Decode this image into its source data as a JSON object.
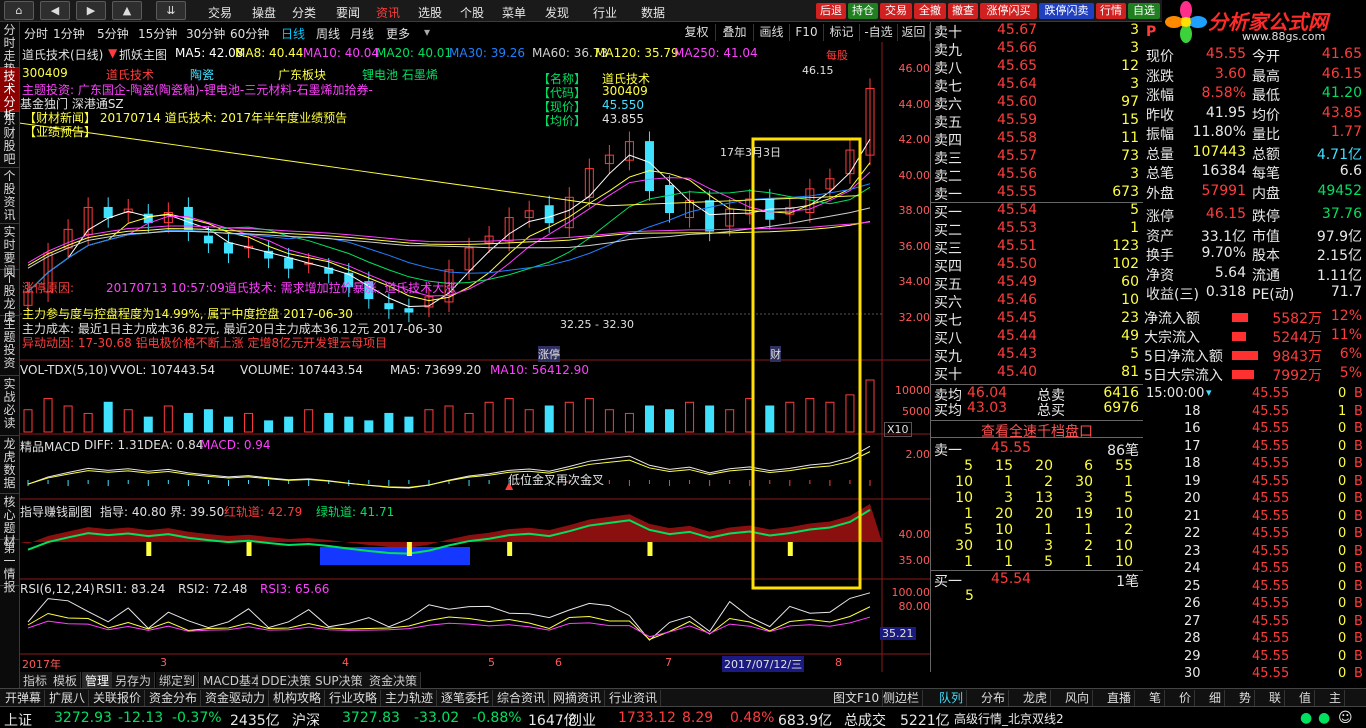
{
  "toolbar": {
    "nav_icons": [
      "home-icon",
      "back-icon",
      "forward-icon",
      "up-icon",
      "collapse-icon"
    ],
    "menus": [
      "交易",
      "操盘",
      "分类",
      "要闻",
      "资讯",
      "选股",
      "个股",
      "菜单",
      "发现",
      "行业",
      "数据"
    ],
    "active_menu": "资讯",
    "right_buttons": [
      "后退",
      "持仓",
      "交易",
      "全撤",
      "撤查",
      "涨停闪买",
      "跌停闪卖",
      "行情",
      "自选"
    ],
    "logo_text": "分析家公式网",
    "logo_url": "www.88gs.com"
  },
  "left_tabs": [
    "分时走势",
    "技术分析",
    "东财股吧",
    "个股资讯",
    "实时要闻",
    "个股龙虎",
    "主题投资",
    "实战必读",
    "龙虎数据",
    "核心题材",
    "第一情报"
  ],
  "period": {
    "items": [
      "分时",
      "1分钟",
      "5分钟",
      "15分钟",
      "30分钟",
      "60分钟",
      "日线",
      "周线",
      "月线",
      "更多"
    ],
    "active": "日线"
  },
  "chart_controls": [
    "复权",
    "叠加",
    "画线",
    "F10",
    "标记",
    "-自选",
    "返回"
  ],
  "main_chart": {
    "title_line": "道氏技术(日线)",
    "pick_label": "抓妖主图",
    "ma": [
      {
        "label": "MA5: 42.08",
        "color": "#ffffff"
      },
      {
        "label": "MA8: 40.44",
        "color": "#ffff40"
      },
      {
        "label": "MA10: 40.04",
        "color": "#ff40ff"
      },
      {
        "label": "MA20: 40.01",
        "color": "#00e060"
      },
      {
        "label": "MA30: 39.26",
        "color": "#2080ff"
      },
      {
        "label": "MA60: 36.73",
        "color": "#d0d0d0"
      },
      {
        "label": "MA120: 35.79",
        "color": "#ffff40"
      },
      {
        "label": "MA250: 41.04",
        "color": "#ff40ff"
      }
    ],
    "code": "300409",
    "tags": [
      "道氏技术",
      "陶瓷",
      "广东板块",
      "锂电池 石墨烯"
    ],
    "concept_line": "主题投资: 广东国企-陶瓷(陶瓷釉)-锂电池-三元材料-石墨烯加拾券-",
    "market_line": "基金独门 深港通SZ",
    "news1": "【财材新闻】 20170714 道氏技术: 2017年半年度业绩预告",
    "news2": "【业绩预告】",
    "info_box": {
      "name_label": "【名称】",
      "name": "道氏技术",
      "code_label": "【代码】",
      "code": "300409",
      "price_label": "【现价】",
      "price": "45.550",
      "avg_label": "【均价】",
      "avg": "43.855"
    },
    "reason_label": "涨停原因:",
    "reason_text": "20170713 10:57:09道氏技术: 需求增加拉价暴涨, 道氏技术大涨",
    "fund_line": "主力参与度与控盘程度为14.99%, 属于中度控盘 2017-06-30",
    "cost_line": "主力成本: 最近1日主力成本36.82元, 最近20日主力成本36.12元 2017-06-30",
    "abnormal_line": "异动动因: 17-30.68 铝电极价格不断上涨 定增8亿元开发锂云母项目",
    "range_label": "32.25 - 32.30",
    "peak_label": "46.15",
    "date_marker": "17年3月3日",
    "stop_tag": "涨停",
    "cai_tag": "财",
    "meigu": "每股",
    "y_ticks": [
      "46.00",
      "44.00",
      "42.00",
      "40.00",
      "38.00",
      "36.00",
      "34.00",
      "32.00"
    ]
  },
  "chart_data": [
    {
      "type": "candlestick",
      "title": "道氏技术(日线)",
      "x": [
        "2017-03",
        "2017-04",
        "2017-05",
        "2017-06",
        "2017-07",
        "2017-08"
      ],
      "ylim": [
        31,
        47
      ],
      "series": [
        {
          "name": "MA5",
          "last": 42.08
        },
        {
          "name": "MA8",
          "last": 40.44
        },
        {
          "name": "MA10",
          "last": 40.04
        },
        {
          "name": "MA20",
          "last": 40.01
        },
        {
          "name": "MA30",
          "last": 39.26
        },
        {
          "name": "MA60",
          "last": 36.73
        },
        {
          "name": "MA120",
          "last": 35.79
        },
        {
          "name": "MA250",
          "last": 41.04
        }
      ],
      "close_path": [
        33.5,
        35.8,
        37.2,
        38.5,
        37.9,
        38.4,
        37.6,
        38.2,
        37.1,
        36.4,
        35.8,
        36.2,
        35.5,
        34.9,
        35.2,
        34.6,
        33.8,
        33.1,
        32.5,
        32.3,
        33.2,
        34.8,
        36.1,
        36.8,
        37.9,
        38.3,
        37.6,
        39.1,
        40.8,
        41.6,
        42.4,
        39.5,
        38.2,
        38.9,
        37.1,
        38.4,
        39.0,
        37.8,
        38.5,
        39.6,
        40.2,
        41.9,
        45.55
      ]
    },
    {
      "type": "bar",
      "title": "VOL-TDX(5,10)",
      "series": [
        {
          "name": "VOLUME",
          "last": 107443.54
        },
        {
          "name": "MA5",
          "last": 73699.2
        },
        {
          "name": "MA10",
          "last": 56412.9
        }
      ],
      "y_ticks": [
        "10000",
        "5000"
      ],
      "values": [
        6,
        9,
        7,
        5,
        8,
        6,
        4,
        7,
        5,
        6,
        4,
        5,
        3,
        4,
        6,
        5,
        4,
        3,
        5,
        4,
        6,
        7,
        5,
        8,
        9,
        6,
        7,
        8,
        9,
        6,
        5,
        7,
        6,
        8,
        7,
        6,
        9,
        7,
        8,
        9,
        8,
        10,
        14
      ]
    },
    {
      "type": "line",
      "title": "精品MACD",
      "series": [
        {
          "name": "DIFF",
          "last": 1.31
        },
        {
          "name": "DEA",
          "last": 0.84
        },
        {
          "name": "MACD",
          "last": 0.94
        }
      ],
      "y_ticks": [
        "2.00"
      ]
    },
    {
      "type": "area",
      "title": "指导赚钱副图",
      "series": [
        {
          "name": "指导",
          "last": 40.8
        },
        {
          "name": "界",
          "last": 39.5
        },
        {
          "name": "红轨道",
          "last": 42.79
        },
        {
          "name": "绿轨道",
          "last": 41.71
        }
      ],
      "y_ticks": [
        "40.00",
        "35.00"
      ]
    },
    {
      "type": "line",
      "title": "RSI(6,12,24)",
      "series": [
        {
          "name": "RSI1",
          "last": 83.24
        },
        {
          "name": "RSI2",
          "last": 72.48
        },
        {
          "name": "RSI3",
          "last": 65.66
        }
      ],
      "y_ticks": [
        "100.00",
        "80.00",
        "35.21"
      ]
    }
  ],
  "subcharts": {
    "vol_title": "VOL-TDX(5,10)",
    "vol_vals": "VVOL: 107443.54",
    "vol_volume": "VOLUME: 107443.54",
    "vol_ma5": "MA5: 73699.20",
    "vol_ma10": "MA10: 56412.90",
    "x10": "X10",
    "macd_title": "精品MACD",
    "macd_diff": "DIFF: 1.31",
    "macd_dea": "DEA: 0.84",
    "macd_macd": "MACD: 0.94",
    "macd_note": "低位金叉再次金叉",
    "guide_title": "指导赚钱副图",
    "guide_vals": "指导: 40.80 界: 39.50",
    "guide_red": "红轨道: 42.79",
    "guide_green": "绿轨道: 41.71",
    "rsi_title": "RSI(6,12,24)",
    "rsi1": "RSI1: 83.24",
    "rsi2": "RSI2: 72.48",
    "rsi3": "RSI3: 65.66"
  },
  "x_axis": {
    "labels": [
      "2017年",
      "3",
      "4",
      "5",
      "6",
      "7",
      "8"
    ],
    "cursor_date": "2017/07/12/三"
  },
  "chart_bottom_tabs": [
    "指标",
    "模板",
    "管理",
    "另存为",
    "绑定到",
    "MACD基本",
    "DDE决策",
    "SUP决策",
    "资金决策"
  ],
  "quote": {
    "sell": [
      {
        "label": "卖十",
        "price": "45.67",
        "vol": "3"
      },
      {
        "label": "卖九",
        "price": "45.66",
        "vol": "3"
      },
      {
        "label": "卖八",
        "price": "45.65",
        "vol": "12"
      },
      {
        "label": "卖七",
        "price": "45.64",
        "vol": "3"
      },
      {
        "label": "卖六",
        "price": "45.60",
        "vol": "97"
      },
      {
        "label": "卖五",
        "price": "45.59",
        "vol": "15"
      },
      {
        "label": "卖四",
        "price": "45.58",
        "vol": "11"
      },
      {
        "label": "卖三",
        "price": "45.57",
        "vol": "73"
      },
      {
        "label": "卖二",
        "price": "45.56",
        "vol": "3"
      },
      {
        "label": "卖一",
        "price": "45.55",
        "vol": "673"
      }
    ],
    "buy": [
      {
        "label": "买一",
        "price": "45.54",
        "vol": "5"
      },
      {
        "label": "买二",
        "price": "45.53",
        "vol": "1"
      },
      {
        "label": "买三",
        "price": "45.51",
        "vol": "123"
      },
      {
        "label": "买四",
        "price": "45.50",
        "vol": "102"
      },
      {
        "label": "买五",
        "price": "45.49",
        "vol": "60"
      },
      {
        "label": "买六",
        "price": "45.46",
        "vol": "10"
      },
      {
        "label": "买七",
        "price": "45.45",
        "vol": "23"
      },
      {
        "label": "买八",
        "price": "45.44",
        "vol": "49"
      },
      {
        "label": "买九",
        "price": "45.43",
        "vol": "5"
      },
      {
        "label": "买十",
        "price": "45.40",
        "vol": "81"
      }
    ],
    "avg_sell_label": "卖均",
    "avg_sell": "46.04",
    "total_sell_label": "总卖",
    "total_sell": "6416",
    "avg_buy_label": "买均",
    "avg_buy": "43.03",
    "total_buy_label": "总买",
    "total_buy": "6976",
    "depth_link": "查看全速千档盘口",
    "depth_sell1_label": "卖一",
    "depth_sell1_price": "45.55",
    "depth_sell1_count": "86笔",
    "depth_grid": [
      [
        "5",
        "15",
        "20",
        "6",
        "55"
      ],
      [
        "10",
        "1",
        "2",
        "30",
        "1"
      ],
      [
        "10",
        "3",
        "13",
        "3",
        "5"
      ],
      [
        "1",
        "20",
        "20",
        "19",
        "10"
      ],
      [
        "5",
        "10",
        "1",
        "1",
        "2"
      ],
      [
        "30",
        "10",
        "3",
        "2",
        "10"
      ],
      [
        "1",
        "1",
        "5",
        "1",
        "10"
      ]
    ],
    "depth_buy1_label": "买一",
    "depth_buy1_price": "45.54",
    "depth_buy1_count": "1笔",
    "depth_buy_first": "5"
  },
  "fund": {
    "title": "P",
    "rows": [
      {
        "l1": "现价",
        "v1": "45.55",
        "c1": "red",
        "l2": "今开",
        "v2": "41.65",
        "c2": "red"
      },
      {
        "l1": "涨跌",
        "v1": "3.60",
        "c1": "red",
        "l2": "最高",
        "v2": "46.15",
        "c2": "red"
      },
      {
        "l1": "涨幅",
        "v1": "8.58%",
        "c1": "red",
        "l2": "最低",
        "v2": "41.20",
        "c2": "grn"
      },
      {
        "l1": "昨收",
        "v1": "41.95",
        "c1": "wht",
        "l2": "均价",
        "v2": "43.85",
        "c2": "red"
      },
      {
        "l1": "振幅",
        "v1": "11.80%",
        "c1": "wht",
        "l2": "量比",
        "v2": "1.77",
        "c2": "red"
      },
      {
        "l1": "总量",
        "v1": "107443",
        "c1": "ylw",
        "l2": "总额",
        "v2": "4.71亿",
        "c2": "cyn"
      },
      {
        "l1": "总笔",
        "v1": "16384",
        "c1": "wht",
        "l2": "每笔",
        "v2": "6.6",
        "c2": "wht"
      },
      {
        "l1": "外盘",
        "v1": "57991",
        "c1": "red",
        "l2": "内盘",
        "v2": "49452",
        "c2": "grn"
      },
      {
        "l1": "涨停",
        "v1": "46.15",
        "c1": "red",
        "l2": "跌停",
        "v2": "37.76",
        "c2": "grn"
      },
      {
        "l1": "资产",
        "v1": "33.1亿",
        "c1": "wht",
        "l2": "市值",
        "v2": "97.9亿",
        "c2": "wht"
      },
      {
        "l1": "换手",
        "v1": "9.70%",
        "c1": "wht",
        "l2": "股本",
        "v2": "2.15亿",
        "c2": "wht"
      },
      {
        "l1": "净资",
        "v1": "5.64",
        "c1": "wht",
        "l2": "流通",
        "v2": "1.11亿",
        "c2": "wht"
      },
      {
        "l1": "收益(三)",
        "v1": "0.318",
        "c1": "wht",
        "l2": "PE(动)",
        "v2": "71.7",
        "c2": "wht"
      }
    ],
    "flows": [
      {
        "label": "净流入额",
        "value": "5582万",
        "pct": "12%",
        "bar": 0.6
      },
      {
        "label": "大宗流入",
        "value": "5244万",
        "pct": "11%",
        "bar": 0.55
      },
      {
        "label": "5日净流入额",
        "value": "9843万",
        "pct": "6%",
        "bar": 1.0
      },
      {
        "label": "5日大宗流入",
        "value": "7992万",
        "pct": "5%",
        "bar": 0.85
      }
    ]
  },
  "ticks": {
    "head_time": "15:00:00",
    "rows": [
      {
        "t": "15:00:00",
        "p1": "45.55",
        "v1": "0",
        "s1": "S",
        "p2": "45.55",
        "v2": "0",
        "s2": "B"
      },
      {
        "t": "18",
        "p1": "45.55",
        "v1": "0",
        "s1": "B",
        "p2": "45.55",
        "v2": "1",
        "s2": "B"
      },
      {
        "t": "16",
        "p1": "45.55",
        "v1": "0",
        "s1": "B",
        "p2": "45.55",
        "v2": "0",
        "s2": "B"
      },
      {
        "t": "17",
        "p1": "45.55",
        "v1": "1",
        "s1": "B",
        "p2": "45.55",
        "v2": "0",
        "s2": "B"
      },
      {
        "t": "18",
        "p1": "45.55",
        "v1": "0",
        "s1": "B",
        "p2": "45.55",
        "v2": "0",
        "s2": "B"
      },
      {
        "t": "19",
        "p1": "45.55",
        "v1": "0",
        "s1": "B",
        "p2": "45.55",
        "v2": "0",
        "s2": "B"
      },
      {
        "t": "20",
        "p1": "45.55",
        "v1": "0",
        "s1": "B",
        "p2": "45.55",
        "v2": "0",
        "s2": "B"
      },
      {
        "t": "21",
        "p1": "45.55",
        "v1": "0",
        "s1": "B",
        "p2": "45.55",
        "v2": "0",
        "s2": "B"
      },
      {
        "t": "22",
        "p1": "45.55",
        "v1": "0",
        "s1": "B",
        "p2": "45.55",
        "v2": "0",
        "s2": "B"
      },
      {
        "t": "23",
        "p1": "45.55",
        "v1": "0",
        "s1": "B",
        "p2": "45.55",
        "v2": "0",
        "s2": "B"
      },
      {
        "t": "24",
        "p1": "45.55",
        "v1": "0",
        "s1": "B",
        "p2": "45.55",
        "v2": "0",
        "s2": "B"
      },
      {
        "t": "25",
        "p1": "45.55",
        "v1": "0",
        "s1": "B",
        "p2": "45.55",
        "v2": "0",
        "s2": "B"
      },
      {
        "t": "26",
        "p1": "45.55",
        "v1": "0",
        "s1": "B",
        "p2": "45.55",
        "v2": "0",
        "s2": "B"
      },
      {
        "t": "27",
        "p1": "45.55",
        "v1": "0",
        "s1": "B",
        "p2": "45.55",
        "v2": "0",
        "s2": "B"
      },
      {
        "t": "28",
        "p1": "45.55",
        "v1": "0",
        "s1": "B",
        "p2": "45.55",
        "v2": "0",
        "s2": "B"
      },
      {
        "t": "29",
        "p1": "45.55",
        "v1": "0",
        "s1": "B",
        "p2": "45.55",
        "v2": "0",
        "s2": "B"
      },
      {
        "t": "30",
        "p1": "45.55",
        "v1": "0",
        "s1": "B",
        "p2": "45.55",
        "v2": "0",
        "s2": "B"
      }
    ]
  },
  "bottom_tabs": [
    "开弹幕",
    "扩展八",
    "关联报价",
    "资金分布",
    "资金驱动力",
    "机构攻略",
    "行业攻略",
    "主力轨迹",
    "逐笔委托",
    "综合资讯",
    "网摘资讯",
    "行业资讯"
  ],
  "bottom_tabs_right": [
    "图文F10",
    "侧边栏"
  ],
  "right_bottom_tabs": [
    "队列",
    "分布",
    "龙虎",
    "风向",
    "直播",
    "笔",
    "价",
    "细",
    "势",
    "联",
    "值",
    "主"
  ],
  "status": {
    "items": [
      {
        "label": "上证",
        "v": "3272.93",
        "c": "-12.13",
        "p": "-0.37%",
        "amt": "2435亿"
      },
      {
        "label": "沪深",
        "v": "3727.83",
        "c": "-33.02",
        "p": "-0.88%",
        "amt": "1647亿"
      },
      {
        "label": "创业",
        "v": "1733.12",
        "c": "8.29",
        "p": "0.48%",
        "amt": "683.9亿"
      }
    ],
    "total_label": "总成交",
    "total": "5221亿",
    "feed": "高级行情_北京双线2"
  }
}
